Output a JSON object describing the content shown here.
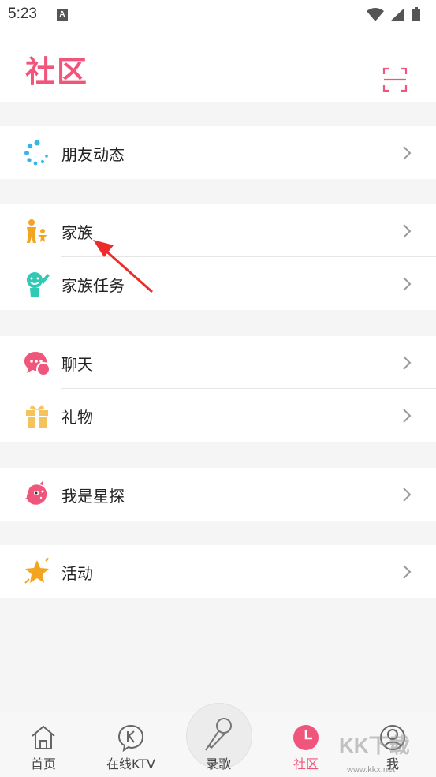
{
  "status_bar": {
    "time": "5:23",
    "notification_letter": "A"
  },
  "header": {
    "title": "社区"
  },
  "menu": [
    [
      {
        "label": "朋友动态",
        "icon": "friends-feed-icon"
      }
    ],
    [
      {
        "label": "家族",
        "icon": "family-icon"
      },
      {
        "label": "家族任务",
        "icon": "family-task-icon"
      }
    ],
    [
      {
        "label": "聊天",
        "icon": "chat-icon"
      },
      {
        "label": "礼物",
        "icon": "gift-icon"
      }
    ],
    [
      {
        "label": "我是星探",
        "icon": "talent-scout-icon"
      }
    ],
    [
      {
        "label": "活动",
        "icon": "event-star-icon"
      }
    ]
  ],
  "tabs": [
    {
      "label": "首页",
      "icon": "home-icon"
    },
    {
      "label": "在线KTV",
      "icon": "ktv-icon"
    },
    {
      "label": "录歌",
      "icon": "microphone-icon"
    },
    {
      "label": "社区",
      "icon": "community-clock-icon",
      "active": true
    },
    {
      "label": "我",
      "icon": "profile-icon"
    }
  ],
  "colors": {
    "accent": "#f0567c",
    "blue": "#35b6e6",
    "orange": "#f3a522",
    "teal": "#2fc9b4"
  },
  "watermark": {
    "text": "KK下载",
    "site": "www.kkx.net"
  }
}
